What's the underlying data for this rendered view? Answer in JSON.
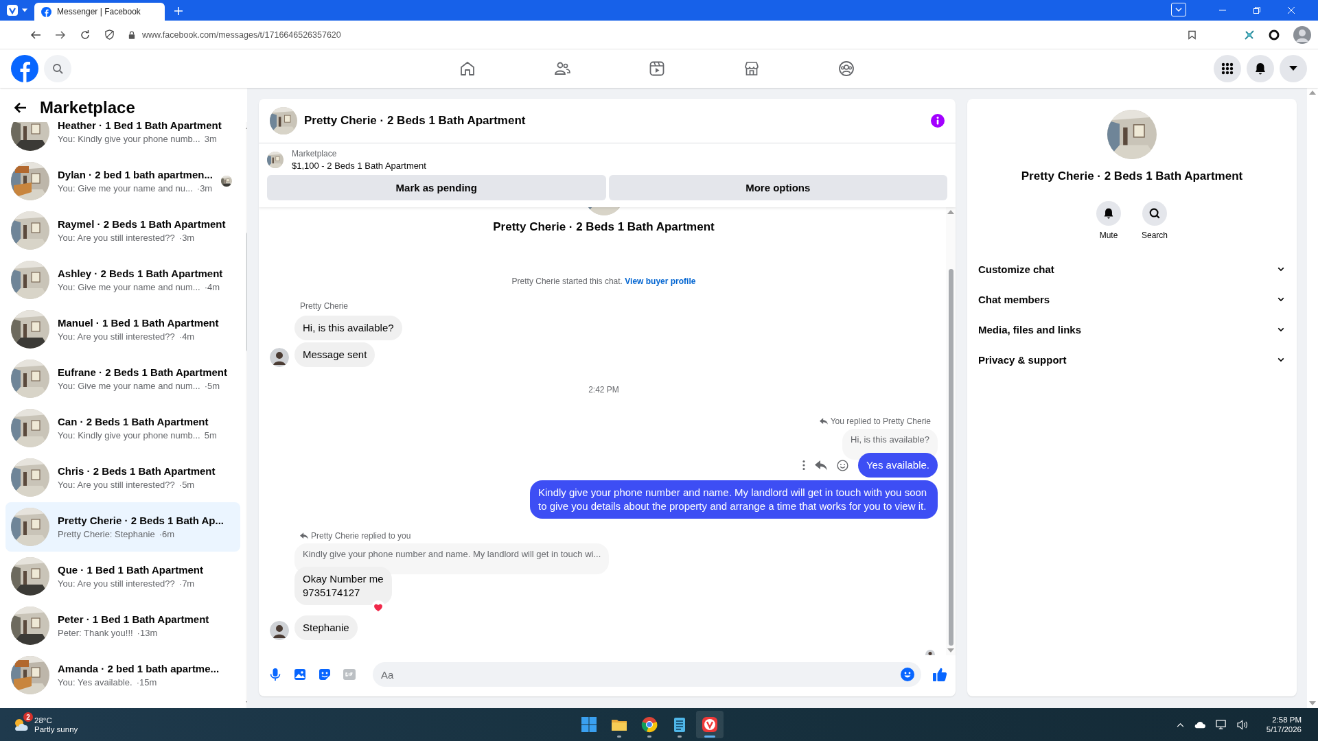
{
  "browser": {
    "tabs": [
      {
        "title": "Messenger | Facebook",
        "selected": true
      }
    ],
    "url": "www.facebook.com/messages/t/1716646526357620"
  },
  "sidebar": {
    "title": "Marketplace",
    "conversations": [
      {
        "name": "Heather · 1 Bed 1 Bath Apartment",
        "preview": "You: Kindly give your phone numb...",
        "time": "3m",
        "selected": false,
        "seen": false
      },
      {
        "name": "Dylan · 2 bed 1 bath apartmen...",
        "preview": "You: Give me your name and nu...",
        "time": "·3m",
        "selected": false,
        "seen": true
      },
      {
        "name": "Raymel · 2 Beds 1 Bath Apartment",
        "preview": "You: Are you still interested??",
        "time": "·3m",
        "selected": false,
        "seen": false
      },
      {
        "name": "Ashley · 2 Beds 1 Bath Apartment",
        "preview": "You: Give me your name and num...",
        "time": "·4m",
        "selected": false,
        "seen": false
      },
      {
        "name": "Manuel · 1 Bed 1 Bath Apartment",
        "preview": "You: Are you still interested??",
        "time": "·4m",
        "selected": false,
        "seen": false
      },
      {
        "name": "Eufrane · 2 Beds 1 Bath Apartment",
        "preview": "You: Give me your name and num...",
        "time": "·5m",
        "selected": false,
        "seen": false
      },
      {
        "name": "Can · 2 Beds 1 Bath Apartment",
        "preview": "You: Kindly give your phone numb...",
        "time": "5m",
        "selected": false,
        "seen": false
      },
      {
        "name": "Chris · 2 Beds 1 Bath Apartment",
        "preview": "You: Are you still interested??",
        "time": "·5m",
        "selected": false,
        "seen": false
      },
      {
        "name": "Pretty Cherie · 2 Beds 1 Bath Ap...",
        "preview": "Pretty Cherie: Stephanie",
        "time": "·6m",
        "selected": true,
        "seen": false
      },
      {
        "name": "Que · 1 Bed 1 Bath Apartment",
        "preview": "You: Are you still interested??",
        "time": "·7m",
        "selected": false,
        "seen": false
      },
      {
        "name": "Peter · 1 Bed 1 Bath Apartment",
        "preview": "Peter: Thank you!!!",
        "time": "·13m",
        "selected": false,
        "seen": false
      },
      {
        "name": "Amanda · 2 bed 1 bath apartme...",
        "preview": "You: Yes available.",
        "time": "·15m",
        "selected": false,
        "seen": false
      }
    ]
  },
  "chat": {
    "title": "Pretty Cherie · 2 Beds 1 Bath Apartment",
    "listing": {
      "source": "Marketplace",
      "title": "$1,100 - 2 Beds 1 Bath Apartment"
    },
    "buttons": [
      "Mark as pending",
      "More options"
    ],
    "intro_title": "Pretty Cherie · 2 Beds 1 Bath Apartment",
    "intro_text": "Pretty Cherie started this chat.",
    "intro_link": "View buyer profile",
    "messages": [
      {
        "kind": "sender",
        "text": "Pretty Cherie"
      },
      {
        "kind": "in",
        "text": "Hi, is this available?",
        "avatar": false,
        "reaction": false
      },
      {
        "kind": "in",
        "text": "Message sent",
        "avatar": true,
        "reaction": false
      },
      {
        "kind": "time",
        "text": "2:42 PM"
      },
      {
        "kind": "reply_note_out",
        "text": "You replied to Pretty Cherie"
      },
      {
        "kind": "quote_out",
        "text": "Hi, is this available?"
      },
      {
        "kind": "out",
        "text": "Yes available.",
        "actions": true
      },
      {
        "kind": "out",
        "text": "Kindly give your phone number and name. My landlord will get in touch with you soon to give you details about the property and arrange a time that works for you to view it.",
        "actions": false
      },
      {
        "kind": "reply_note_in",
        "text": "Pretty Cherie replied to you"
      },
      {
        "kind": "quote_in",
        "text": "Kindly give your phone number and name. My landlord will get in touch wi..."
      },
      {
        "kind": "in",
        "text": "Okay Number me\n9735174127",
        "avatar": false,
        "reaction": true
      },
      {
        "kind": "in",
        "text": "Stephanie",
        "avatar": true,
        "reaction": false
      },
      {
        "kind": "seen"
      }
    ],
    "composer": {
      "placeholder": "Aa"
    }
  },
  "details": {
    "title": "Pretty Cherie · 2 Beds 1 Bath Apartment",
    "actions": [
      {
        "kind": "mute",
        "label": "Mute"
      },
      {
        "kind": "search",
        "label": "Search"
      }
    ],
    "sections": [
      {
        "label": "Customize chat",
        "expanded": false
      },
      {
        "label": "Chat members",
        "expanded": false
      },
      {
        "label": "Media, files and links",
        "expanded": false
      },
      {
        "label": "Privacy & support",
        "expanded": false
      }
    ]
  },
  "taskbar": {
    "weather": {
      "badge": "2",
      "temperature": "28°C",
      "condition": "Partly sunny"
    },
    "apps": [
      {
        "kind": "start",
        "running": false,
        "selected": false
      },
      {
        "kind": "folder",
        "running": true,
        "selected": false
      },
      {
        "kind": "browser",
        "running": true,
        "selected": false
      },
      {
        "kind": "notepad",
        "running": true,
        "selected": false
      },
      {
        "kind": "vivaldi",
        "running": true,
        "selected": true
      }
    ],
    "time": "2:58 PM",
    "date": "5/17/2026"
  }
}
